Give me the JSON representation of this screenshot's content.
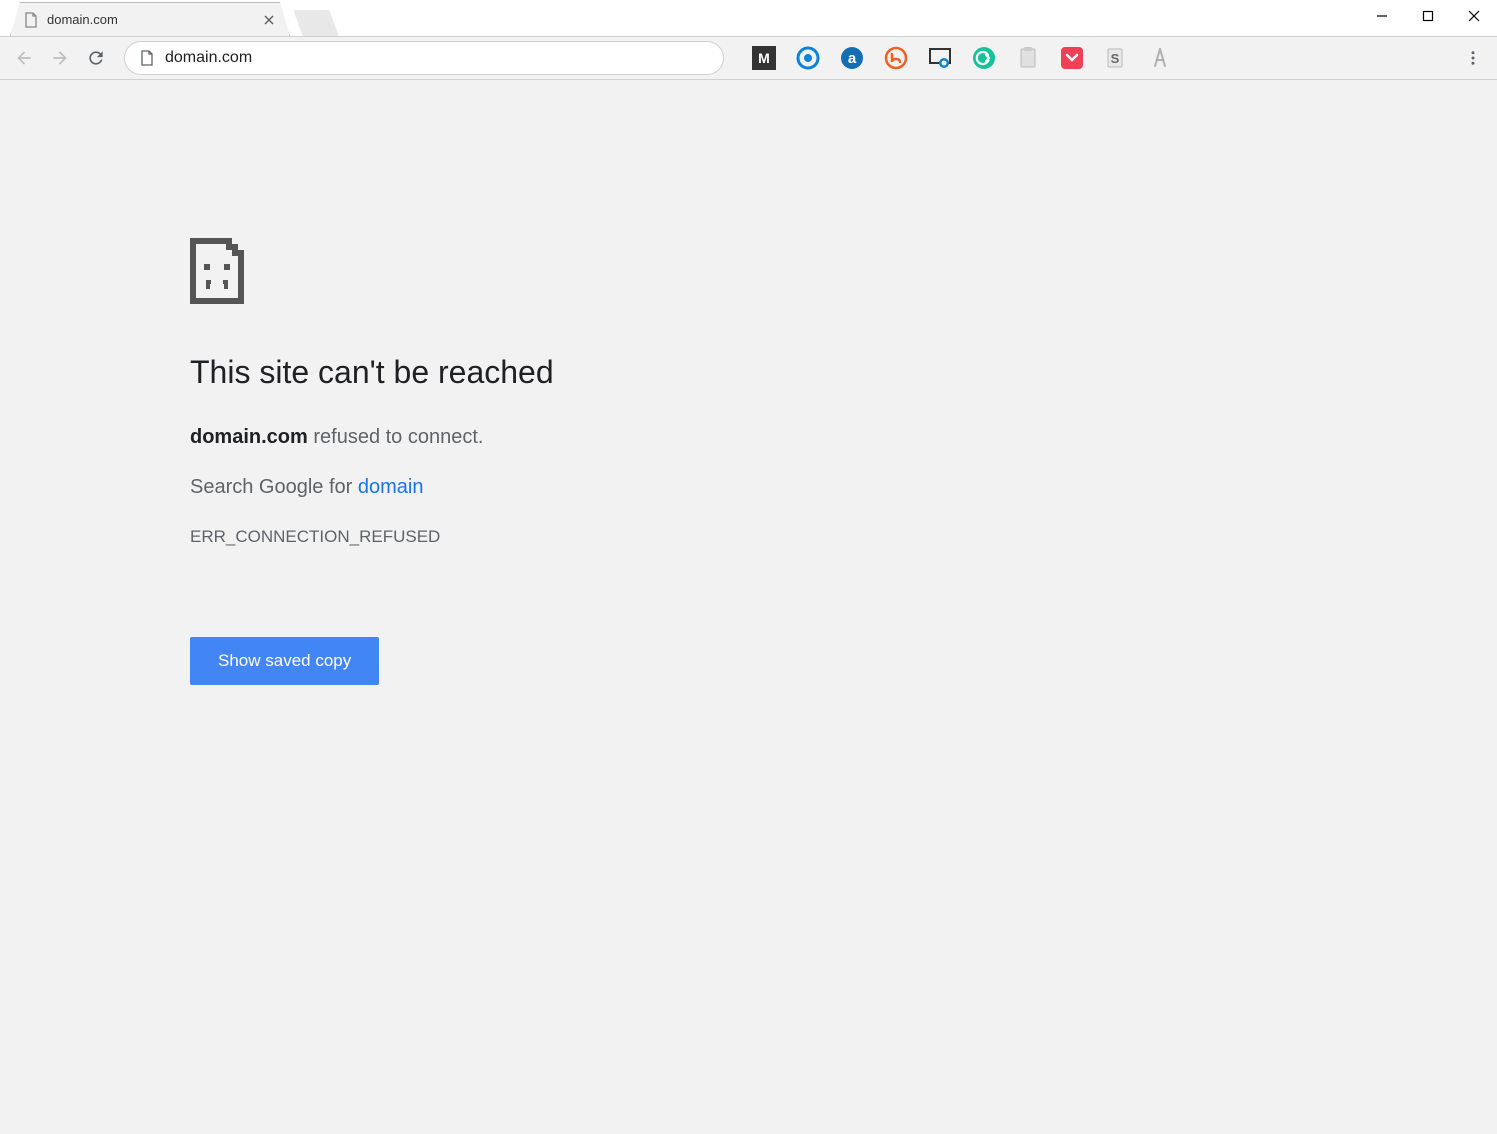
{
  "window": {
    "tab": {
      "title": "domain.com"
    }
  },
  "toolbar": {
    "url": "domain.com"
  },
  "extensions": [
    {
      "name": "megasync",
      "color": "#333",
      "bg": "#333",
      "letter": "M"
    },
    {
      "name": "circle-blue",
      "color": "#0a84d8"
    },
    {
      "name": "amazon",
      "color": "#fff",
      "bg": "#146eb4",
      "letter": "a"
    },
    {
      "name": "bitly",
      "color": "#ee6123"
    },
    {
      "name": "screenshot",
      "color": "#0a84d8"
    },
    {
      "name": "grammarly",
      "color": "#15c39a"
    },
    {
      "name": "clipboard-gray",
      "color": "#c4c4c4"
    },
    {
      "name": "pocket",
      "color": "#ef4056"
    },
    {
      "name": "sessionbuddy",
      "color": "#888",
      "letter": "S"
    },
    {
      "name": "compass-gray",
      "color": "#b0b0b0"
    }
  ],
  "error": {
    "title": "This site can't be reached",
    "domain": "domain.com",
    "message_suffix": " refused to connect.",
    "search_prefix": "Search Google for ",
    "search_term": "domain",
    "code": "ERR_CONNECTION_REFUSED",
    "button_label": "Show saved copy"
  }
}
